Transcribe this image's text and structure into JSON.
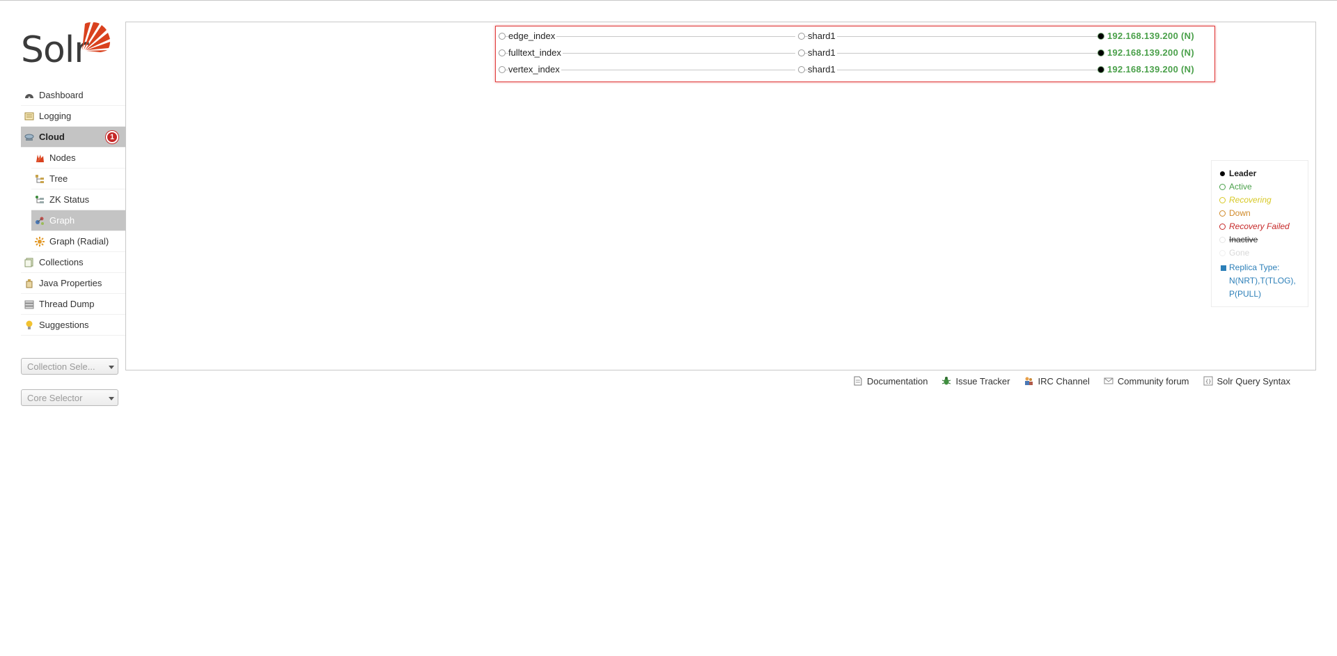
{
  "app": {
    "logo_text": "Solr"
  },
  "sidebar": {
    "items": [
      {
        "label": "Dashboard",
        "icon": "dashboard-icon"
      },
      {
        "label": "Logging",
        "icon": "logging-icon"
      },
      {
        "label": "Cloud",
        "icon": "cloud-icon",
        "active": true,
        "badge": "1"
      }
    ],
    "cloud_subitems": [
      {
        "label": "Nodes",
        "icon": "nodes-icon"
      },
      {
        "label": "Tree",
        "icon": "tree-icon"
      },
      {
        "label": "ZK Status",
        "icon": "zk-status-icon"
      },
      {
        "label": "Graph",
        "icon": "graph-icon",
        "selected": true
      },
      {
        "label": "Graph (Radial)",
        "icon": "graph-radial-icon"
      }
    ],
    "more_items": [
      {
        "label": "Collections",
        "icon": "collections-icon"
      },
      {
        "label": "Java Properties",
        "icon": "java-properties-icon"
      },
      {
        "label": "Thread Dump",
        "icon": "thread-dump-icon"
      },
      {
        "label": "Suggestions",
        "icon": "suggestions-icon"
      }
    ],
    "collection_selector": "Collection Sele...",
    "core_selector": "Core Selector"
  },
  "graph": {
    "rows": [
      {
        "collection": "edge_index",
        "shard": "shard1",
        "replica": "192.168.139.200 (N)"
      },
      {
        "collection": "fulltext_index",
        "shard": "shard1",
        "replica": "192.168.139.200 (N)"
      },
      {
        "collection": "vertex_index",
        "shard": "shard1",
        "replica": "192.168.139.200 (N)"
      }
    ],
    "replica_state_color": "#4aa04a"
  },
  "legend": {
    "leader": "Leader",
    "active": "Active",
    "recovering": "Recovering",
    "down": "Down",
    "recovery_failed": "Recovery Failed",
    "inactive": "Inactive",
    "gone": "Gone",
    "replica_type_1": "Replica Type:",
    "replica_type_2": "N(NRT),T(TLOG),",
    "replica_type_3": "P(PULL)",
    "colors": {
      "active": "#4aa04a",
      "recovering": "#d7c824",
      "down": "#d08a2a",
      "recovery_failed": "#c62828",
      "inactive": "#cccccc",
      "replica_type": "#2c7fb8"
    }
  },
  "footer": {
    "links": [
      {
        "label": "Documentation",
        "icon": "documentation-icon"
      },
      {
        "label": "Issue Tracker",
        "icon": "issue-tracker-icon"
      },
      {
        "label": "IRC Channel",
        "icon": "irc-channel-icon"
      },
      {
        "label": "Community forum",
        "icon": "community-forum-icon"
      },
      {
        "label": "Solr Query Syntax",
        "icon": "solr-query-syntax-icon"
      }
    ]
  }
}
